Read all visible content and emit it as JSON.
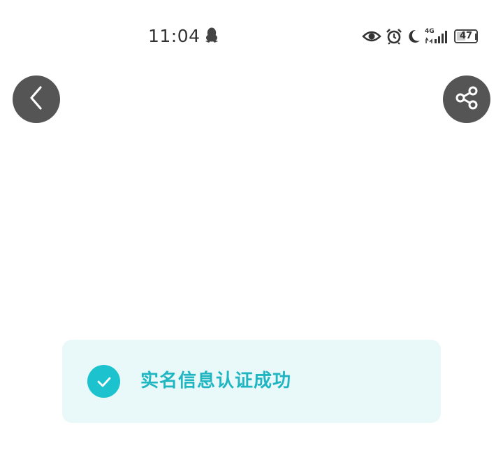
{
  "status_bar": {
    "time": "11:04",
    "network_label": "4G",
    "battery_level": "47",
    "battery_fraction": 0.47,
    "icons": [
      "qq-penguin-icon",
      "eye-icon",
      "alarm-icon",
      "moon-icon",
      "signal-4g-icon",
      "battery-icon"
    ]
  },
  "nav": {
    "back_icon": "chevron-left-icon",
    "share_icon": "share-icon"
  },
  "result": {
    "message": "实名信息认证成功",
    "icon": "check-icon"
  },
  "colors": {
    "accent": "#1cc3cf",
    "accent_text": "#1fb6c2",
    "card_bg": "#e9f8f9",
    "button_bg": "#555555"
  }
}
